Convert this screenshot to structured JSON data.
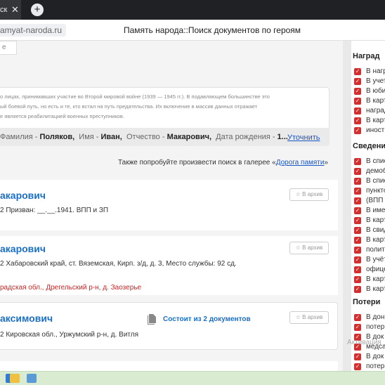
{
  "browser": {
    "tab_label": "ск",
    "tab_close": "✕",
    "new_tab": "+",
    "url": "amyat-naroda.ru",
    "title": "Память народа::Поиск документов по героям"
  },
  "search": {
    "hint_fragment": "е",
    "info_line1": "о лицах, принимавших участие во Второй мировой войне (1939 — 1945 гг.). В подавляющем большинстве это",
    "info_line2": "ый боевой путь, но есть и те, кто встал на путь предательства. Их включение в массив данных отражает",
    "info_line3": "е является реабилитацией военных преступников.",
    "query": {
      "surname_label": "Фамилия",
      "surname_value": "Поляков,",
      "name_label": "Имя",
      "name_value": "Иван,",
      "patronymic_label": "Отчество",
      "patronymic_value": "Макарович,",
      "birth_label": "Дата рождения",
      "birth_value": "1..."
    },
    "refine_label": "Уточнить",
    "road_hint_prefix": "Также попробуйте произвести поиск в галерее «",
    "road_hint_link": "Дорога памяти",
    "road_hint_suffix": "»"
  },
  "results": [
    {
      "name": "акарович",
      "desc": "2 Призван: __.__.1941. ВПП и ЗП",
      "place": "",
      "action": "☆ В архив",
      "docs": ""
    },
    {
      "name": "акарович",
      "desc": "2 Хабаровский край, ст. Вяземская, Кирп. з/д, д. 3, Место службы: 92 сд.",
      "place": "радская обл., Дрегельский р-н, д. Заозерье",
      "action": "☆ В архив",
      "docs": ""
    },
    {
      "name": "аксимович",
      "desc": "2 Кировская обл., Уржумский р-н, д. Витля",
      "place": "",
      "action": "☆ В архив",
      "docs": "Состоит из 2 документов"
    }
  ],
  "filters": {
    "awards_title": "Наград",
    "awards": [
      "В нагр",
      "В учет",
      "В юби",
      "В карт",
      "наград",
      "В карт",
      "иност"
    ],
    "info_title": "Сведени",
    "info": [
      "В спис",
      "демоб",
      "В спис",
      "пункто",
      "(ВПП",
      "В име",
      "В карт",
      "В свид",
      "В карт",
      "полит",
      "В учёт",
      "офице",
      "В карт",
      "В карт"
    ],
    "losses_title": "Потери",
    "losses": [
      "В дон",
      "потер",
      "В док",
      "медса",
      "В док",
      "потер"
    ]
  },
  "watermark": "Активация",
  "colors": {
    "accent": "#1a6fc9",
    "checkbox": "#d32f2f",
    "link": "#1a56c4",
    "place": "#c62828"
  }
}
